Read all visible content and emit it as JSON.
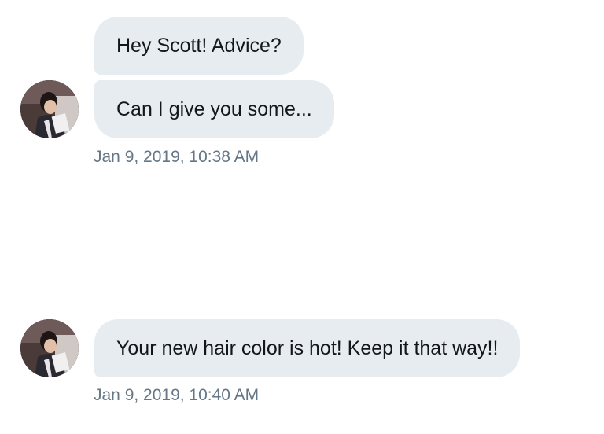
{
  "conversation": {
    "groups": [
      {
        "messages": [
          {
            "text": "Hey Scott! Advice?"
          },
          {
            "text": "Can I give you some..."
          }
        ],
        "timestamp": "Jan 9, 2019, 10:38 AM",
        "avatar_icon": "user-avatar"
      },
      {
        "messages": [
          {
            "text": "Your new hair color is hot! Keep it that way!!"
          }
        ],
        "timestamp": "Jan 9, 2019, 10:40 AM",
        "avatar_icon": "user-avatar"
      }
    ]
  },
  "colors": {
    "bubble_bg": "#e6ecf0",
    "text": "#14171a",
    "timestamp": "#657786"
  }
}
